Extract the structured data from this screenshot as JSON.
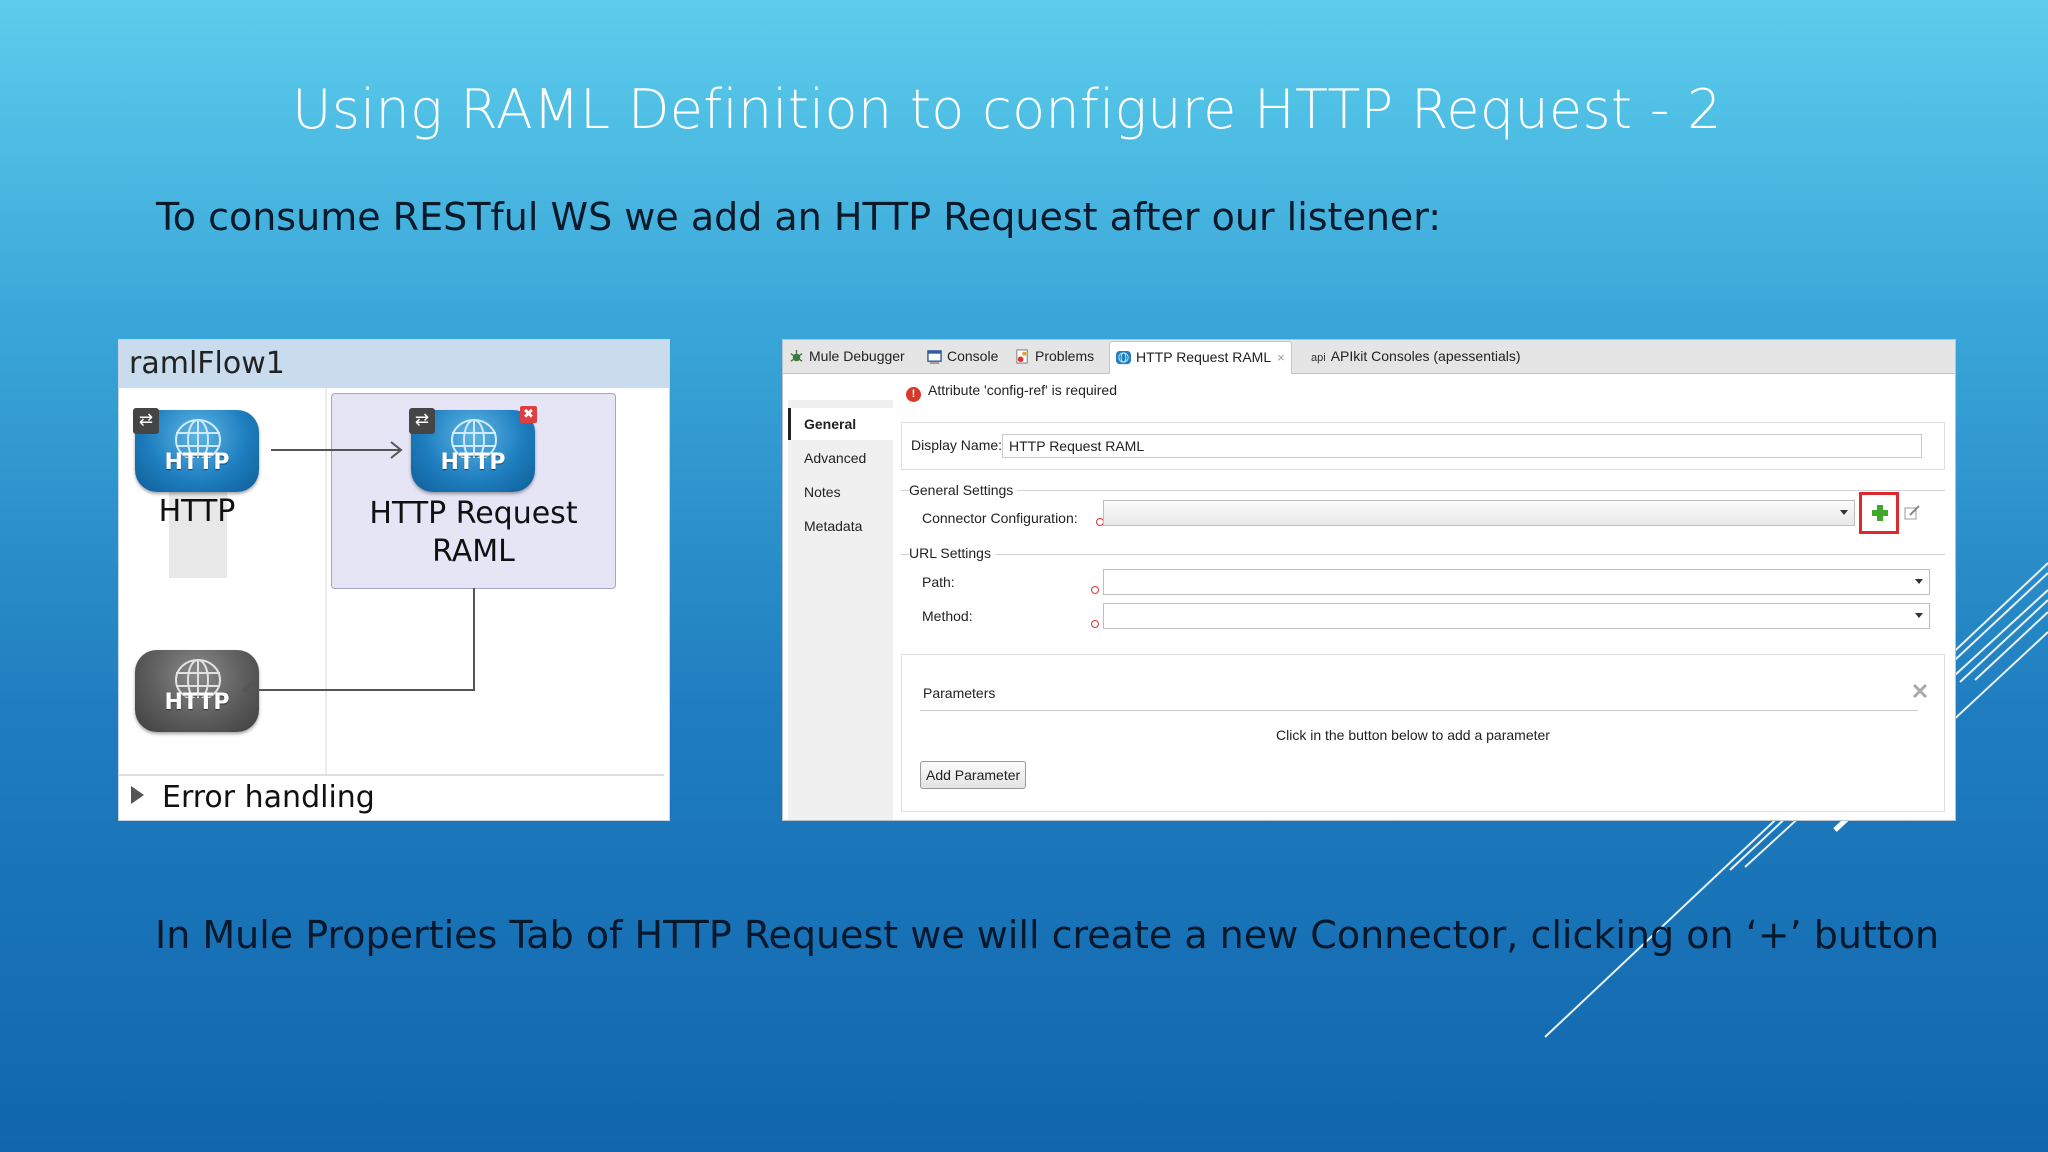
{
  "slide": {
    "title": "Using RAML Definition to configure HTTP Request - 2",
    "subtitle": "To consume RESTful WS we add an HTTP Request after our listener:",
    "caption": "In Mule Properties Tab of HTTP Request we will create a new Connector, clicking on ‘+’ button"
  },
  "flow": {
    "name": "ramlFlow1",
    "nodes": [
      {
        "icon_text": "HTTP",
        "label": "HTTP"
      },
      {
        "icon_text": "HTTP",
        "label_line1": "HTTP Request",
        "label_line2": "RAML"
      },
      {
        "icon_text": "HTTP"
      }
    ],
    "error_handling": "Error handling"
  },
  "properties": {
    "tabs": [
      {
        "label": "Mule Debugger",
        "icon": "bug-icon"
      },
      {
        "label": "Console",
        "icon": "console-icon"
      },
      {
        "label": "Problems",
        "icon": "problems-icon"
      },
      {
        "label": "HTTP Request RAML",
        "icon": "globe-icon",
        "active": true
      },
      {
        "label": "APIkit Consoles (apessentials)",
        "icon": "api-icon",
        "icon_text": "api"
      }
    ],
    "error_message": "Attribute 'config-ref' is required",
    "sidebar": [
      "General",
      "Advanced",
      "Notes",
      "Metadata"
    ],
    "display_name_label": "Display Name:",
    "display_name_value": "HTTP Request RAML",
    "general_settings_title": "General Settings",
    "connector_config_label": "Connector Configuration:",
    "connector_config_value": "",
    "url_settings_title": "URL Settings",
    "path_label": "Path:",
    "path_value": "",
    "method_label": "Method:",
    "method_value": "",
    "parameters_title": "Parameters",
    "parameters_hint": "Click in the button below to add a parameter",
    "add_parameter_label": "Add Parameter",
    "colors": {
      "accent_red": "#e0282c",
      "plus_green": "#3fa82b"
    }
  }
}
